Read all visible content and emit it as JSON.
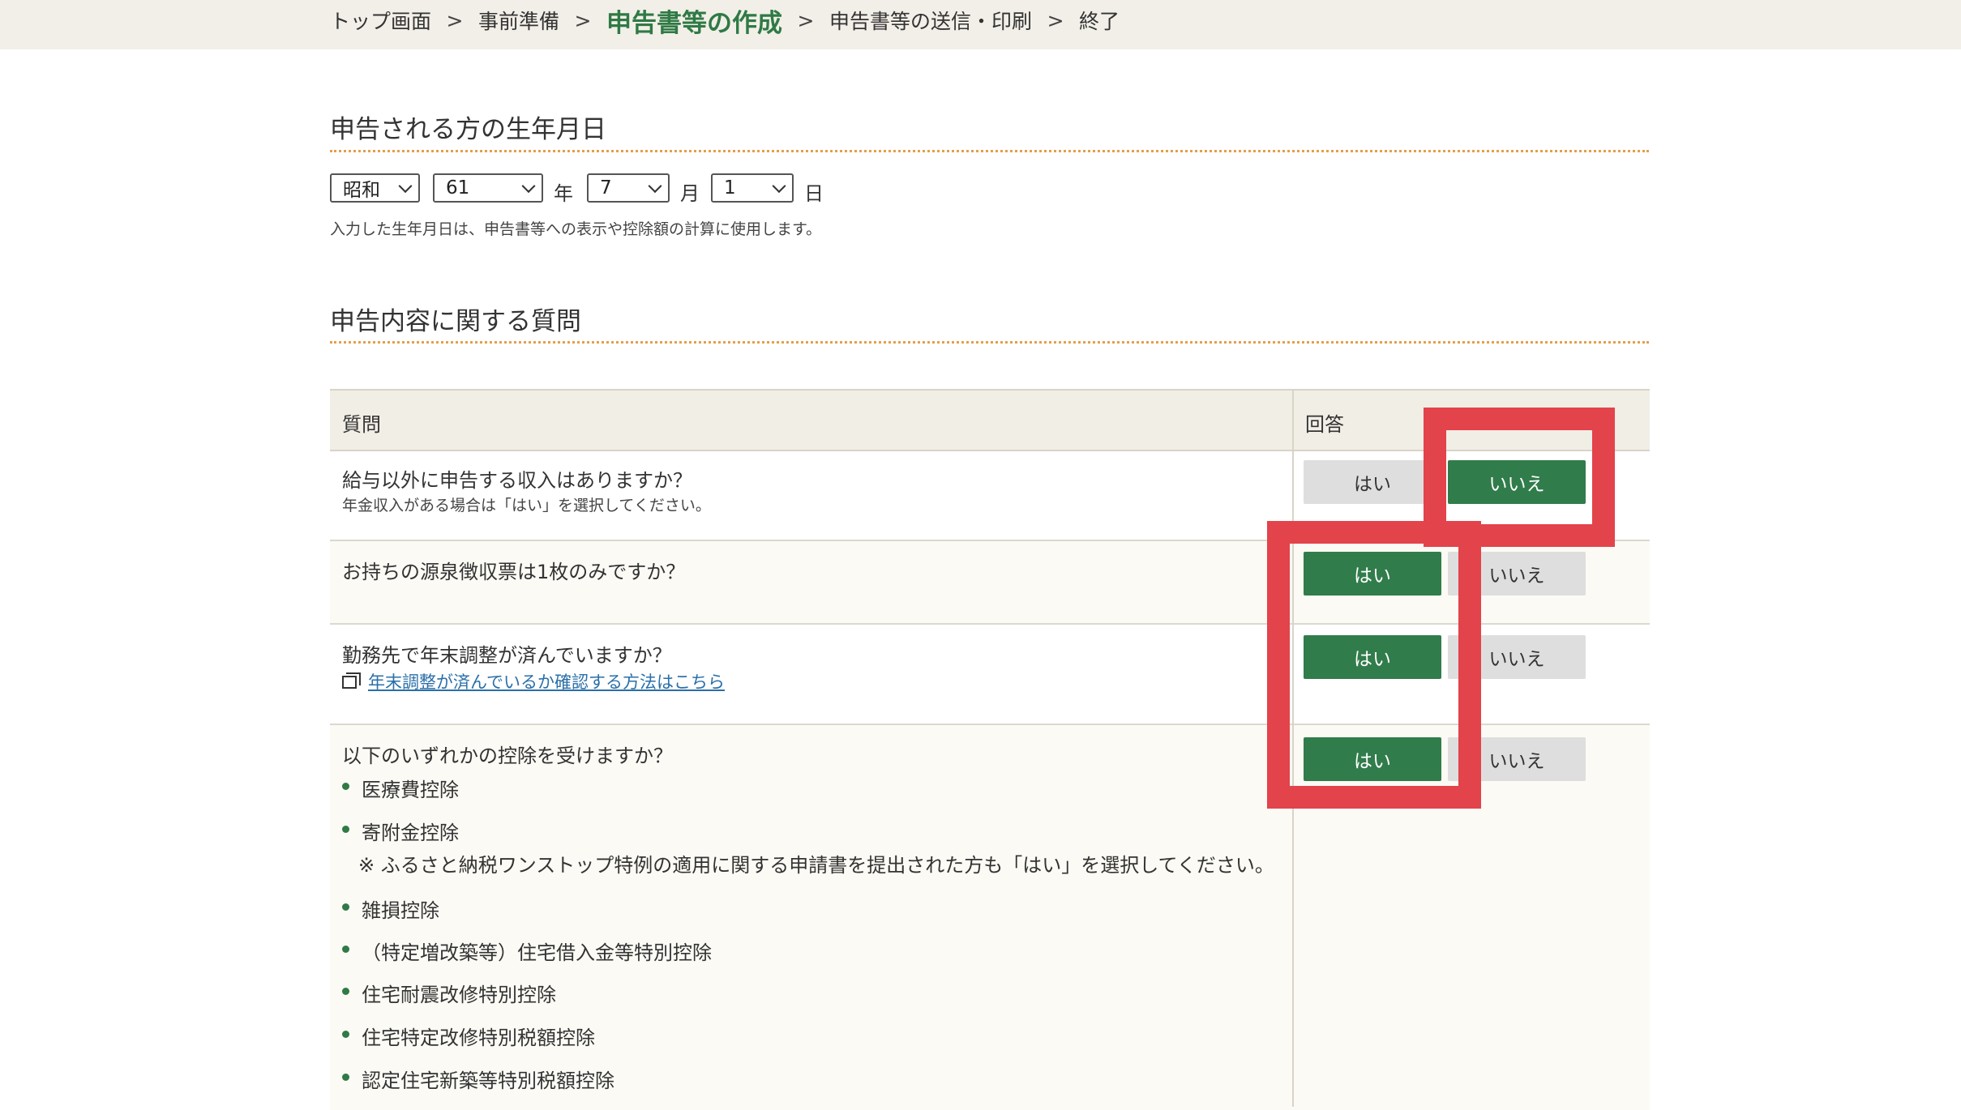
{
  "breadcrumb": {
    "items": [
      "トップ画面",
      "事前準備",
      "申告書等の作成",
      "申告書等の送信・印刷",
      "終了"
    ],
    "separator": ">"
  },
  "birthdate": {
    "title": "申告される方の生年月日",
    "era": "昭和",
    "year": "61",
    "year_unit": "年",
    "month": "7",
    "month_unit": "月",
    "day": "1",
    "day_unit": "日",
    "note": "入力した生年月日は、申告書等への表示や控除額の計算に使用します。"
  },
  "questions_section": {
    "title": "申告内容に関する質問",
    "header_question": "質問",
    "header_answer": "回答",
    "yes_label": "はい",
    "no_label": "いいえ",
    "rows": [
      {
        "question": "給与以外に申告する収入はありますか？",
        "sub": "年金収入がある場合は「はい」を選択してください。",
        "selected": "いいえ"
      },
      {
        "question": "お持ちの源泉徴収票は1枚のみですか？",
        "selected": "はい"
      },
      {
        "question": "勤務先で年末調整が済んでいますか？",
        "link": "年末調整が済んでいるか確認する方法はこちら",
        "selected": "はい"
      },
      {
        "question": "以下のいずれかの控除を受けますか？",
        "selected": "はい",
        "deductions": [
          "医療費控除",
          "寄附金控除",
          "雑損控除",
          "（特定増改築等）住宅借入金等特別控除",
          "住宅耐震改修特別控除",
          "住宅特定改修特別税額控除",
          "認定住宅新築等特別税額控除"
        ],
        "furusato_note": "※ ふるさと納税ワンストップ特例の適用に関する申請書を提出された方も「はい」を選択してください。"
      }
    ]
  },
  "colors": {
    "accent_green": "#317c4b",
    "highlight_red": "#e3434b",
    "dotted_orange": "#e3a04b"
  }
}
